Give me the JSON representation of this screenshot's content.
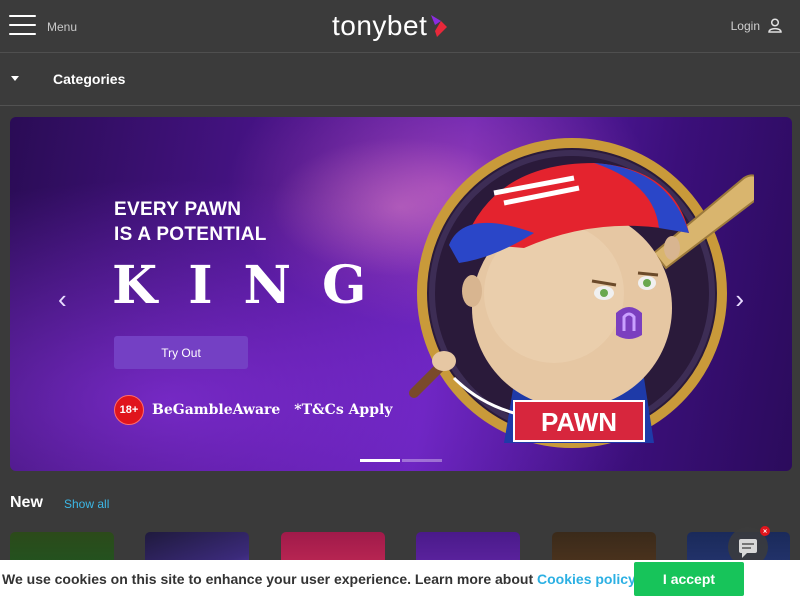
{
  "header": {
    "menu_label": "Menu",
    "logo_text": "tonybet",
    "login_label": "Login"
  },
  "categories": {
    "label": "Categories"
  },
  "banner": {
    "headline_line1": "EVERY PAWN",
    "headline_line2": "IS A POTENTIAL",
    "king": "KING",
    "cta_label": "Try Out",
    "age_badge": "18+",
    "gamble_aware": "BeGambleAware",
    "terms": "*T&Cs Apply",
    "character_label": "PAWN",
    "slides_total": 2,
    "active_slide": 1
  },
  "new_section": {
    "title": "New",
    "show_all_label": "Show all"
  },
  "cookie": {
    "text": "We use cookies on this site to enhance your user experience. Learn more about ",
    "link_label": "Cookies policy.",
    "accept_label": "I accept"
  },
  "colors": {
    "accent_link": "#2cb0e3",
    "accept_green": "#17c45a",
    "cta_purple": "#7440c4",
    "age_red": "#e0141c"
  },
  "icons": [
    "hamburger-icon",
    "user-icon",
    "caret-down-icon",
    "chevron-left-icon",
    "chevron-right-icon",
    "chat-icon"
  ]
}
